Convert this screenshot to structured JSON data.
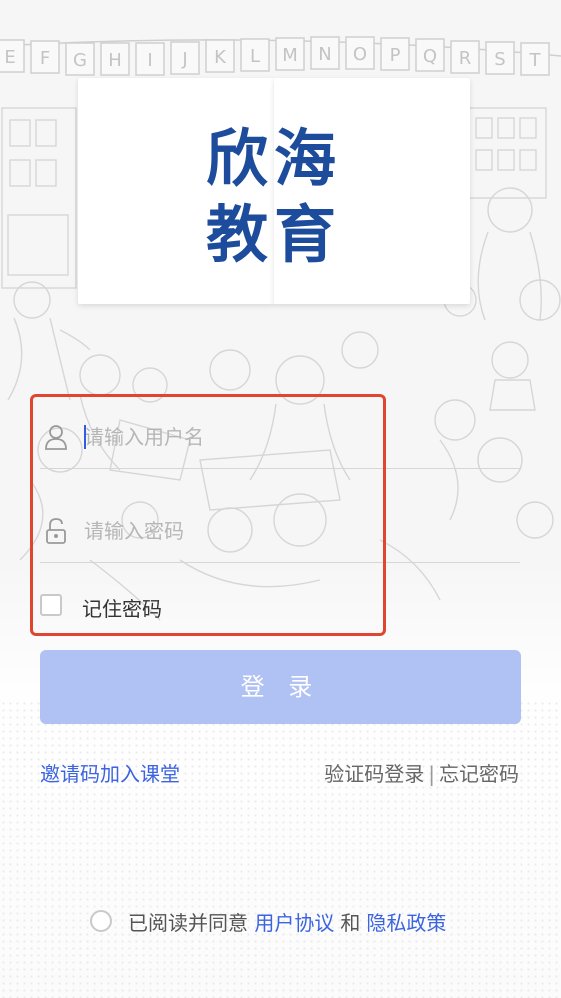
{
  "logo": {
    "line1": "欣海",
    "line2": "教育"
  },
  "banner_letters": [
    "E",
    "F",
    "G",
    "H",
    "I",
    "J",
    "K",
    "L",
    "M",
    "N",
    "O",
    "P",
    "Q",
    "R",
    "S",
    "T"
  ],
  "form": {
    "username_placeholder": "请输入用户名",
    "password_placeholder": "请输入密码",
    "remember_label": "记住密码"
  },
  "login_button": "登 录",
  "links": {
    "invite": "邀请码加入课堂",
    "sms_login": "验证码登录",
    "separator": "|",
    "forgot_password": "忘记密码"
  },
  "agreement": {
    "prefix": "已阅读并同意",
    "user_agreement": "用户协议",
    "and": "和",
    "privacy_policy": "隐私政策"
  },
  "colors": {
    "brand_blue": "#1d4c9c",
    "link_blue": "#3c64e0",
    "button_disabled": "#b0c1f4",
    "highlight_red": "#e0462f"
  }
}
